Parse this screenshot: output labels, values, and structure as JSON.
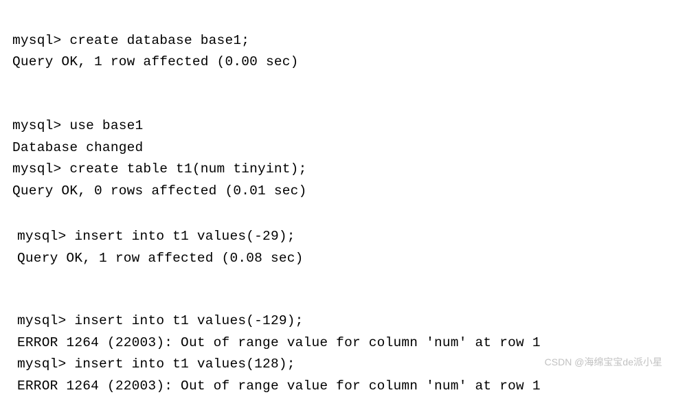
{
  "block1": {
    "line1": "mysql> create database base1;",
    "line2": "Query OK, 1 row affected (0.00 sec)"
  },
  "block2": {
    "line1": "mysql> use base1",
    "line2": "Database changed",
    "line3": "mysql> create table t1(num tinyint);",
    "line4": "Query OK, 0 rows affected (0.01 sec)"
  },
  "block3": {
    "line1": "mysql> insert into t1 values(-29);",
    "line2": "Query OK, 1 row affected (0.08 sec)"
  },
  "block4": {
    "line1": "mysql> insert into t1 values(-129);",
    "line2": "ERROR 1264 (22003): Out of range value for column 'num' at row 1",
    "line3": "mysql> insert into t1 values(128);",
    "line4": "ERROR 1264 (22003): Out of range value for column 'num' at row 1"
  },
  "watermark": "CSDN @海绵宝宝de派小星"
}
